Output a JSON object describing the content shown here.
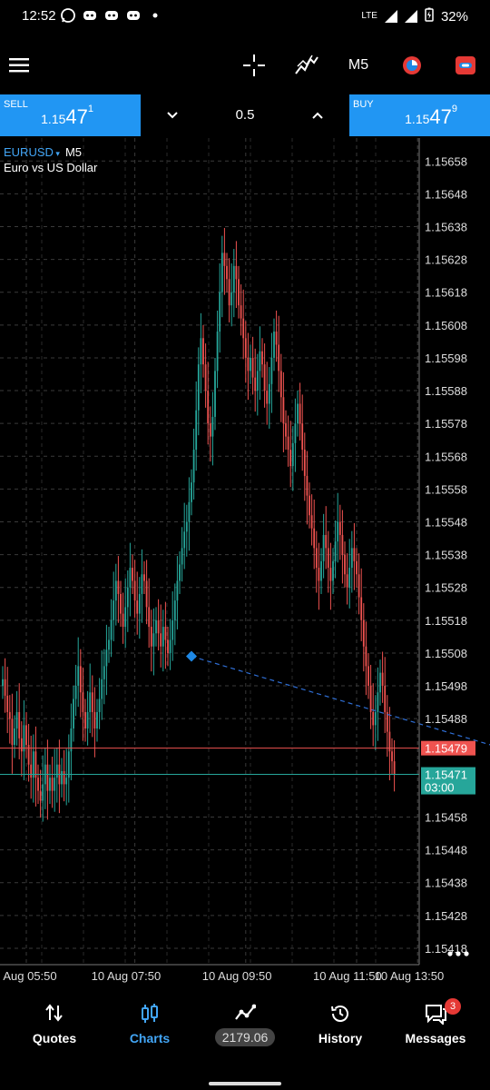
{
  "status_bar": {
    "time": "12:52",
    "network": "LTE",
    "battery": "32%"
  },
  "toolbar": {
    "timeframe": "M5",
    "icons": [
      "menu-icon",
      "crosshair-icon",
      "indicators-icon",
      "objects-icon",
      "trade-icon"
    ]
  },
  "trade": {
    "sell_label": "SELL",
    "sell_price_prefix": "1.15",
    "sell_price_big": "47",
    "sell_price_sup": "1",
    "buy_label": "BUY",
    "buy_price_prefix": "1.15",
    "buy_price_big": "47",
    "buy_price_sup": "9",
    "lot": "0.5"
  },
  "chart": {
    "symbol": "EURUSD",
    "timeframe": "M5",
    "description": "Euro vs US Dollar",
    "countdown": "03:00"
  },
  "chart_data": {
    "type": "candlestick",
    "y_ticks": [
      "1.15658",
      "1.15648",
      "1.15638",
      "1.15628",
      "1.15618",
      "1.15608",
      "1.15598",
      "1.15588",
      "1.15578",
      "1.15568",
      "1.15558",
      "1.15548",
      "1.15538",
      "1.15528",
      "1.15518",
      "1.15508",
      "1.15498",
      "1.15488",
      "1.15458",
      "1.15448",
      "1.15438",
      "1.15428",
      "1.15418"
    ],
    "x_ticks": [
      "10 Aug 05:50",
      "10 Aug 07:50",
      "10 Aug 09:50",
      "10 Aug 11:50",
      "10 Aug 13:50"
    ],
    "ylim": [
      1.15413,
      1.15665
    ],
    "ask_line": "1.15479",
    "bid_line": "1.15471",
    "grid": true,
    "colors": {
      "up": "#26a69a",
      "down": "#ef5350",
      "trend_line": "#2f6fd6"
    },
    "trend_line": {
      "from": [
        80,
        1.15507
      ],
      "to": [
        249,
        1.15471
      ]
    },
    "closes": [
      1.155,
      1.15495,
      1.1549,
      1.15488,
      1.1548,
      1.15485,
      1.1549,
      1.15482,
      1.15478,
      1.15486,
      1.1548,
      1.15474,
      1.1547,
      1.15478,
      1.1547,
      1.15466,
      1.15463,
      1.15468,
      1.15474,
      1.15466,
      1.1547,
      1.15466,
      1.1547,
      1.15474,
      1.15468,
      1.15472,
      1.15468,
      1.1547,
      1.15478,
      1.15485,
      1.15494,
      1.15498,
      1.15504,
      1.15496,
      1.1549,
      1.15485,
      1.1549,
      1.15496,
      1.1549,
      1.15485,
      1.1549,
      1.15494,
      1.155,
      1.15504,
      1.15509,
      1.15512,
      1.15518,
      1.15524,
      1.1553,
      1.15526,
      1.1552,
      1.15516,
      1.15522,
      1.15528,
      1.15534,
      1.1553,
      1.15524,
      1.1552,
      1.15526,
      1.15532,
      1.1553,
      1.15522,
      1.15516,
      1.1551,
      1.15514,
      1.15518,
      1.15514,
      1.1551,
      1.15516,
      1.15512,
      1.15508,
      1.15512,
      1.15518,
      1.15524,
      1.1553,
      1.15535,
      1.1554,
      1.15545,
      1.15548,
      1.15554,
      1.1556,
      1.1557,
      1.15582,
      1.15596,
      1.15604,
      1.15596,
      1.15588,
      1.15578,
      1.15574,
      1.1558,
      1.15594,
      1.15606,
      1.15618,
      1.1563,
      1.15626,
      1.15622,
      1.15614,
      1.15618,
      1.15626,
      1.15622,
      1.15614,
      1.1561,
      1.15604,
      1.15598,
      1.15594,
      1.15598,
      1.15592,
      1.15588,
      1.15594,
      1.156,
      1.15596,
      1.15588,
      1.15584,
      1.1559,
      1.15598,
      1.15606,
      1.15602,
      1.15594,
      1.15586,
      1.15578,
      1.15574,
      1.1557,
      1.15565,
      1.15572,
      1.15578,
      1.15584,
      1.15578,
      1.1557,
      1.15562,
      1.15556,
      1.1555,
      1.15546,
      1.1554,
      1.15534,
      1.1553,
      1.15536,
      1.15544,
      1.1554,
      1.15534,
      1.1553,
      1.15536,
      1.15542,
      1.15548,
      1.15544,
      1.15538,
      1.15532,
      1.15528,
      1.15534,
      1.1554,
      1.15536,
      1.15532,
      1.15525,
      1.15518,
      1.1551,
      1.15504,
      1.15498,
      1.1549,
      1.15486,
      1.1549,
      1.15496,
      1.15502,
      1.15498,
      1.1549,
      1.15484,
      1.15478,
      1.15475,
      1.15471
    ],
    "data_range_note": ""
  },
  "nav": {
    "quotes": "Quotes",
    "charts": "Charts",
    "balance": "2179.06",
    "history": "History",
    "messages": "Messages",
    "messages_badge": "3"
  }
}
